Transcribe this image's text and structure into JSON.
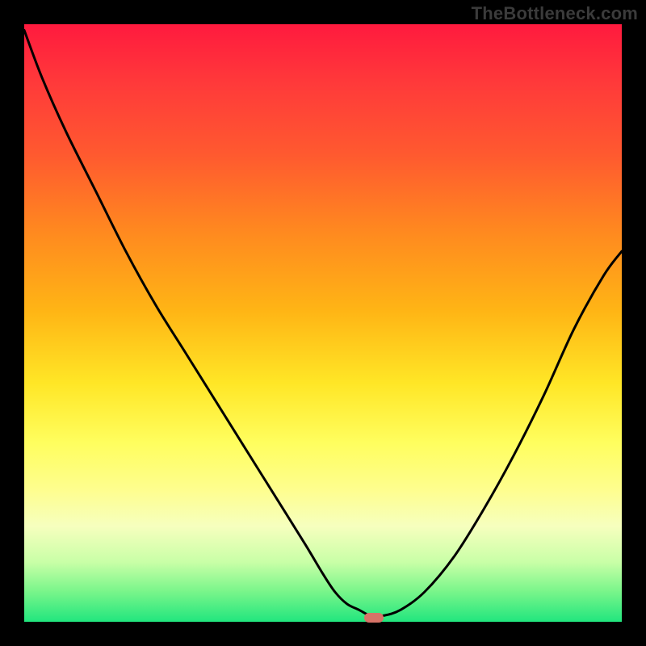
{
  "branding": {
    "watermark": "TheBottleneck.com"
  },
  "colors": {
    "curve_stroke": "#000000",
    "marker_fill": "#d77367",
    "page_bg": "#000000",
    "gradient_top": "#ff1a3e",
    "gradient_bottom": "#21e67e"
  },
  "chart_data": {
    "type": "line",
    "title": "",
    "xlabel": "",
    "ylabel": "",
    "xlim": [
      0,
      100
    ],
    "ylim": [
      0,
      100
    ],
    "grid": false,
    "legend_position": "none",
    "note": "Single curve on a rainbow gradient; y increases upward. Values estimated from pixel position.",
    "series": [
      {
        "name": "bottleneck-curve",
        "x": [
          0,
          3,
          7,
          12,
          17,
          22,
          27,
          32,
          37,
          42,
          47,
          50,
          52,
          54,
          56,
          58,
          60,
          63,
          67,
          72,
          77,
          82,
          87,
          92,
          97,
          100
        ],
        "y": [
          99,
          91,
          82,
          72,
          62,
          53,
          45,
          37,
          29,
          21,
          13,
          8,
          5,
          3,
          2,
          1,
          1,
          2,
          5,
          11,
          19,
          28,
          38,
          49,
          58,
          62
        ]
      }
    ],
    "marker": {
      "x": 58.5,
      "y": 0.7,
      "label": "optimal-point"
    }
  }
}
